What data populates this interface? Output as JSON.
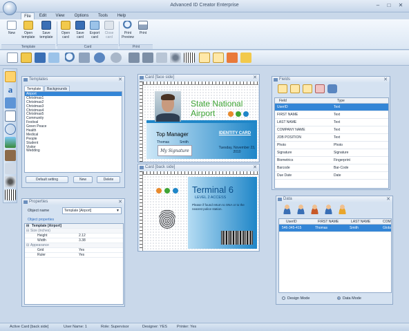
{
  "window": {
    "title": "Advanced ID Creator Enterprise",
    "minimize": "–",
    "maximize": "□",
    "close": "✕"
  },
  "menu": [
    "File",
    "Edit",
    "View",
    "Options",
    "Tools",
    "Help"
  ],
  "ribbon": {
    "buttons": [
      {
        "label": "New",
        "icon": "new-document-icon"
      },
      {
        "label": "Open template",
        "icon": "open-template-icon"
      },
      {
        "label": "Save template",
        "icon": "save-template-icon"
      },
      {
        "label": "Open card",
        "icon": "open-card-icon"
      },
      {
        "label": "Save card",
        "icon": "save-card-icon"
      },
      {
        "label": "Export card",
        "icon": "export-card-icon"
      },
      {
        "label": "Close card",
        "icon": "close-card-icon"
      },
      {
        "label": "Print Preview",
        "icon": "print-preview-icon"
      },
      {
        "label": "Print",
        "icon": "print-icon"
      }
    ],
    "groups": [
      "Template",
      "Card",
      "Print"
    ]
  },
  "templates": {
    "title": "Templates",
    "tabs": [
      "Template",
      "Backgrounds"
    ],
    "items": [
      "Airport",
      "Christmas1",
      "Christmas2",
      "Christmas3",
      "Christmas4",
      "Christmas5",
      "Community",
      "Festival",
      "Green Peace",
      "Health",
      "Medical",
      "People",
      "Student",
      "Visitor",
      "Wedding"
    ],
    "selected": "Airport",
    "buttons": [
      "Default setting",
      "New",
      "Delete"
    ]
  },
  "properties": {
    "title": "Properties",
    "object_name_label": "Object name",
    "object_name_value": "Template [Airport]",
    "object_properties_label": "Object properties",
    "root": "Template [Airport]",
    "size_group": "Size (inches)",
    "height_label": "Height",
    "height_value": "2.12",
    "width_label": "Width",
    "width_value": "3.38",
    "appearance_group": "Appearance",
    "grid_label": "Grid",
    "grid_value": "Yes",
    "ruler_label": "Ruler",
    "ruler_value": "Yes"
  },
  "card_front": {
    "panel_title": "Card [face side]",
    "line1": "State National",
    "line2": "Airport",
    "position": "Top Manager",
    "badge": "IDENTITY CARD",
    "first_name": "Thomas",
    "last_name": "Smith",
    "date": "Tuesday, November 23, 2010",
    "signature": "My Signature"
  },
  "card_back": {
    "panel_title": "Card [back side]",
    "terminal": "Terminal 6",
    "access": "LEVEL 2 ACCESS",
    "notice": "Please if found return to SNA or to the nearest police station."
  },
  "fields": {
    "title": "Fields",
    "columns": [
      "Field",
      "Type"
    ],
    "rows": [
      [
        "UserID",
        "Text"
      ],
      [
        "FIRST NAME",
        "Text"
      ],
      [
        "LAST NAME",
        "Text"
      ],
      [
        "COMPANY NAME",
        "Text"
      ],
      [
        "JOB POSITION",
        "Text"
      ],
      [
        "Photo",
        "Photo"
      ],
      [
        "Signature",
        "Signature"
      ],
      [
        "Biometrics",
        "Fingerprint"
      ],
      [
        "Barcode",
        "Bar-Code"
      ],
      [
        "Due Date",
        "Date"
      ]
    ],
    "selected_row": 0
  },
  "data": {
    "title": "Data",
    "columns": [
      "UserID",
      "FIRST NAME",
      "LAST NAME",
      "COM"
    ],
    "rows": [
      [
        "546-345-415",
        "Thomas",
        "Smith",
        "Globa"
      ]
    ],
    "modes": [
      "Design Mode",
      "Data Mode"
    ],
    "selected_mode": "Data Mode"
  },
  "status": {
    "active_card": "Active Card [back side]",
    "user_name": "User Name: 1",
    "role": "Role: Supervisor",
    "designer": "Designer: YES",
    "printer": "Printer: Yes"
  },
  "colors": {
    "accent": "#3385d6",
    "card_green": "#3fa535",
    "card_blue": "#1f86c8",
    "frame_bg": "#c9d8ea"
  }
}
